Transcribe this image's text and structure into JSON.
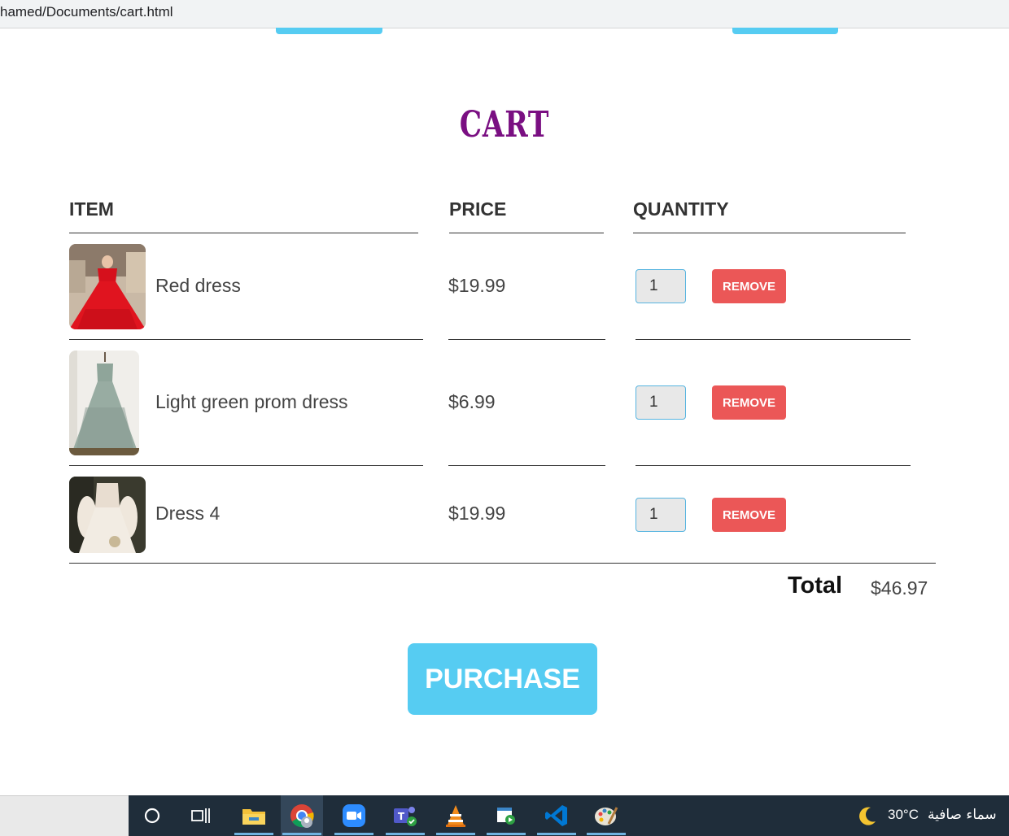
{
  "browser": {
    "url": "hamed/Documents/cart.html"
  },
  "cart": {
    "title": "CART",
    "headers": {
      "item": "ITEM",
      "price": "PRICE",
      "quantity": "QUANTITY"
    },
    "items": [
      {
        "name": "Red dress",
        "price": "$19.99",
        "quantity": "1",
        "remove_label": "REMOVE"
      },
      {
        "name": "Light green prom dress",
        "price": "$6.99",
        "quantity": "1",
        "remove_label": "REMOVE"
      },
      {
        "name": "Dress 4",
        "price": "$19.99",
        "quantity": "1",
        "remove_label": "REMOVE"
      }
    ],
    "total_label": "Total",
    "total_value": "$46.97",
    "purchase_label": "PURCHASE"
  },
  "taskbar": {
    "apps": [
      "search-icon",
      "task-view-icon",
      "file-explorer-icon",
      "chrome-icon",
      "zoom-icon",
      "teams-icon",
      "vlc-icon",
      "media-app-icon",
      "vscode-icon",
      "paint-icon"
    ],
    "weather_temp": "30°C",
    "weather_desc": "سماء صافية"
  },
  "colors": {
    "accent": "#56ccf2",
    "remove": "#eb5757",
    "title": "#7a0f82",
    "taskbar": "#1f2d3a"
  }
}
